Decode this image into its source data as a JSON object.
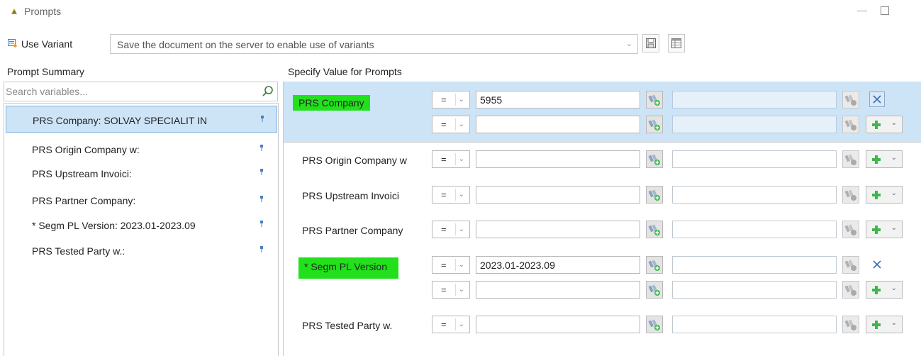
{
  "window": {
    "title": "Prompts"
  },
  "variant": {
    "label": "Use Variant",
    "select_text": "Save the document on the server to enable use of variants"
  },
  "left_panel": {
    "header": "Prompt Summary",
    "search_placeholder": "Search variables...",
    "items": [
      {
        "label": "PRS Company: SOLVAY SPECIALIT IN",
        "selected": true
      },
      {
        "label": "PRS Origin Company w:",
        "selected": false
      },
      {
        "label": "PRS Upstream Invoici:",
        "selected": false
      },
      {
        "label": "PRS Partner Company:",
        "selected": false
      },
      {
        "label": "* Segm PL Version: 2023.01-2023.09",
        "selected": false
      },
      {
        "label": "PRS Tested Party w.:",
        "selected": false
      }
    ]
  },
  "right_panel": {
    "header": "Specify Value for Prompts",
    "prompts": [
      {
        "label": "PRS Company",
        "highlighted": true,
        "rows": [
          {
            "operator": "=",
            "value": "5955",
            "action": "remove"
          },
          {
            "operator": "=",
            "value": "",
            "action": "add"
          }
        ]
      },
      {
        "label": "PRS Origin Company w",
        "highlighted": false,
        "rows": [
          {
            "operator": "=",
            "value": "",
            "action": "add"
          }
        ]
      },
      {
        "label": "PRS Upstream Invoici",
        "highlighted": false,
        "rows": [
          {
            "operator": "=",
            "value": "",
            "action": "add"
          }
        ]
      },
      {
        "label": "PRS Partner Company",
        "highlighted": false,
        "rows": [
          {
            "operator": "=",
            "value": "",
            "action": "add"
          }
        ]
      },
      {
        "label": "* Segm PL Version",
        "highlighted": true,
        "rows": [
          {
            "operator": "=",
            "value": "2023.01-2023.09",
            "action": "remove"
          },
          {
            "operator": "=",
            "value": "",
            "action": "add"
          }
        ]
      },
      {
        "label": "PRS Tested Party w.",
        "highlighted": false,
        "rows": [
          {
            "operator": "=",
            "value": "",
            "action": "add"
          }
        ]
      }
    ]
  },
  "colors": {
    "selection": "#cde4f7",
    "highlight": "#22e01c",
    "border": "#c8c8c8"
  },
  "icons": {
    "app": "prompts-icon",
    "variant": "variant-icon",
    "save": "save-icon",
    "table": "table-icon",
    "search": "search-icon",
    "pin": "pin-icon",
    "value_help": "value-help-icon",
    "remove": "close-icon",
    "add": "plus-icon",
    "dropdown": "chevron-down-icon"
  }
}
